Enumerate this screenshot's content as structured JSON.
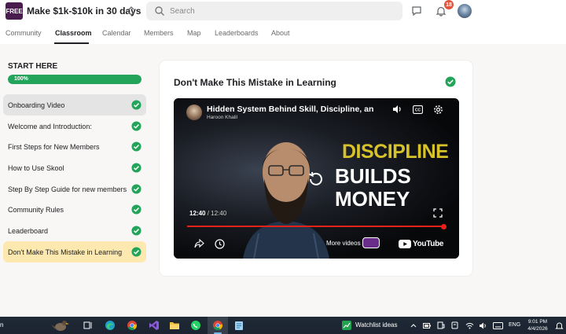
{
  "header": {
    "logo_text": "FREE",
    "group_name": "Make $1k-$10k in 30 days",
    "search_placeholder": "Search",
    "notification_count": "18"
  },
  "tabs": [
    {
      "label": "Community",
      "active": false
    },
    {
      "label": "Classroom",
      "active": true
    },
    {
      "label": "Calendar",
      "active": false
    },
    {
      "label": "Members",
      "active": false
    },
    {
      "label": "Map",
      "active": false
    },
    {
      "label": "Leaderboards",
      "active": false
    },
    {
      "label": "About",
      "active": false
    }
  ],
  "sidebar": {
    "module_title": "START HERE",
    "progress_label": "100%",
    "progress_value": 1.0,
    "lessons": [
      {
        "label": "Onboarding Video",
        "completed": true
      },
      {
        "label": "Welcome and Introduction:",
        "completed": true
      },
      {
        "label": "First Steps for New Members",
        "completed": true
      },
      {
        "label": "How to Use Skool",
        "completed": true
      },
      {
        "label": "Step By Step Guide for new members",
        "completed": true
      },
      {
        "label": "Community Rules",
        "completed": true
      },
      {
        "label": "Leaderboard",
        "completed": true
      },
      {
        "label": "Don't Make This Mistake in Learning",
        "completed": true
      }
    ]
  },
  "main": {
    "lesson_title": "Don't Make This Mistake in Learning",
    "video": {
      "title": "Hidden System Behind Skill, Discipline, and R",
      "channel": "Haroon Khalil",
      "thumbnail_line1": "DISCIPLINE",
      "thumbnail_line2": "BUILDS",
      "thumbnail_line3": "MONEY",
      "time_current": "12:40",
      "time_separator": " / ",
      "time_total": "12:40",
      "more_videos": "More videos",
      "brand": "YouTube",
      "played_fraction": 1.0
    }
  },
  "taskbar": {
    "left_text": "n",
    "watchlist": "Watchlist ideas",
    "lang": "ENG",
    "time": "9:01 PM",
    "date": "4/4/2026"
  },
  "colors": {
    "accent_green": "#23a45a",
    "current_lesson_bg": "#fde9b0",
    "youtube_red": "#e62117"
  }
}
